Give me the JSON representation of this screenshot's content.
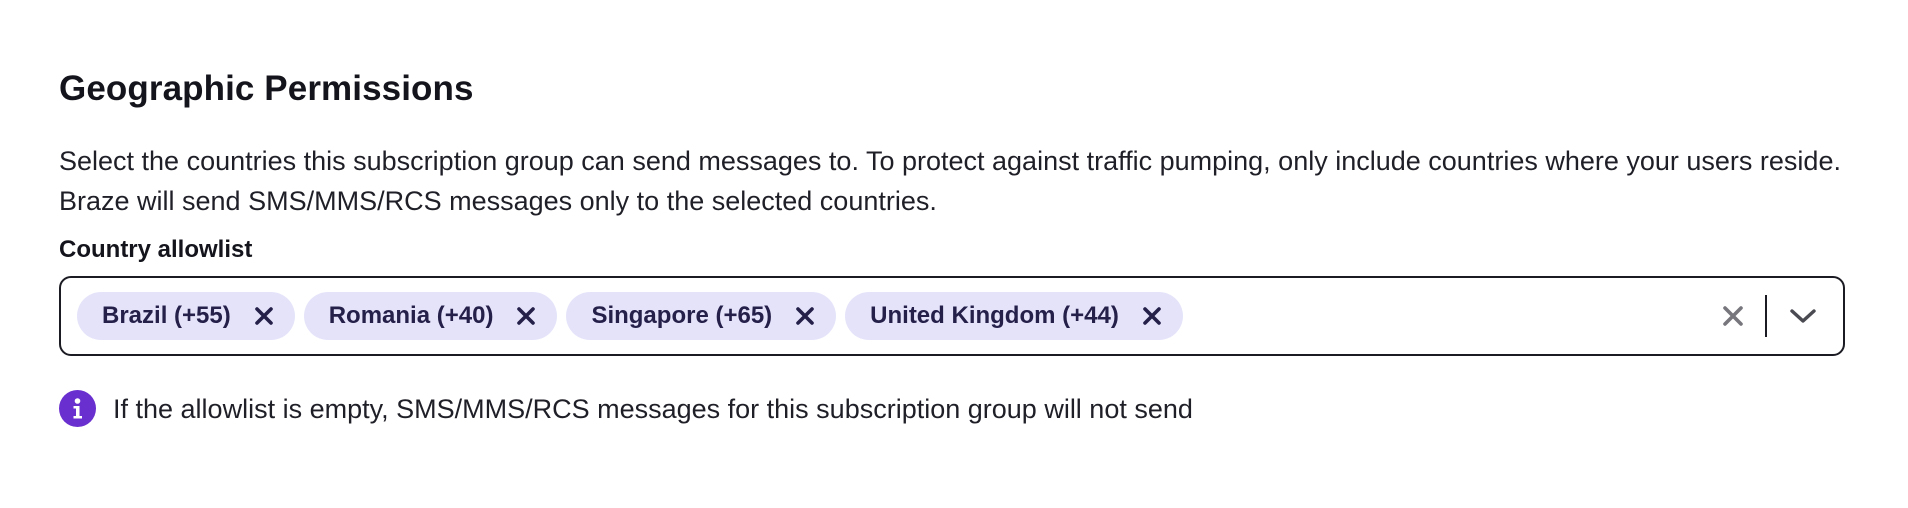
{
  "section": {
    "title": "Geographic Permissions",
    "description": "Select the countries this subscription group can send messages to. To protect against traffic pumping, only include countries where your users reside. Braze will send SMS/MMS/RCS messages only to the selected countries."
  },
  "allowlist": {
    "label": "Country allowlist",
    "selected": [
      {
        "label": "Brazil (+55)",
        "remove_icon": "close-icon"
      },
      {
        "label": "Romania (+40)",
        "remove_icon": "close-icon"
      },
      {
        "label": "Singapore (+65)",
        "remove_icon": "close-icon"
      },
      {
        "label": "United Kingdom (+44)",
        "remove_icon": "close-icon"
      }
    ],
    "clear_icon": "close-icon",
    "dropdown_icon": "chevron-down-icon"
  },
  "info": {
    "icon": "info-icon",
    "text": "If the allowlist is empty, SMS/MMS/RCS messages for this subscription group will not send"
  },
  "colors": {
    "chip_background": "#e4e3fa",
    "chip_text": "#24204a",
    "info_accent": "#6a2fcf",
    "border": "#1b1b23",
    "clear_icon": "#77767d"
  }
}
